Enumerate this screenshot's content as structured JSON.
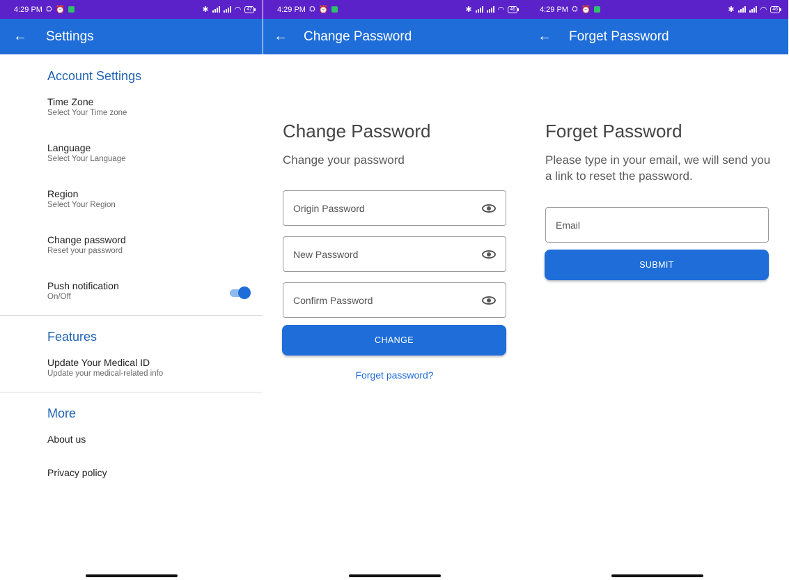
{
  "status_bar": {
    "time": "4:29 PM",
    "battery_left": "47",
    "battery_other": "46"
  },
  "settings": {
    "back_icon": "arrow-left-icon",
    "title": "Settings",
    "account_section": "Account Settings",
    "items": [
      {
        "title": "Time Zone",
        "subtitle": "Select Your Time zone"
      },
      {
        "title": "Language",
        "subtitle": "Select Your Language"
      },
      {
        "title": "Region",
        "subtitle": "Select Your Region"
      },
      {
        "title": "Change password",
        "subtitle": "Reset your password"
      },
      {
        "title": "Push notification",
        "subtitle": "On/Off"
      }
    ],
    "push_enabled": true,
    "features_section": "Features",
    "features_items": [
      {
        "title": "Update Your Medical ID",
        "subtitle": "Update your medical-related info"
      }
    ],
    "more_section": "More",
    "more_items": [
      "About us",
      "Privacy policy"
    ]
  },
  "change_password": {
    "title": "Change Password",
    "heading": "Change Password",
    "subheading": "Change your password",
    "fields": [
      "Origin Password",
      "New Password",
      "Confirm Password"
    ],
    "button": "CHANGE",
    "forgot_link": "Forget password?"
  },
  "forget_password": {
    "title": "Forget Password",
    "heading": "Forget Password",
    "description": "Please type in your email, we will send you a link to reset the password.",
    "email_placeholder": "Email",
    "button": "SUBMIT"
  },
  "colors": {
    "app_bar": "#1e6dd8",
    "status_bar": "#5a22c8",
    "section": "#1f63b5"
  }
}
